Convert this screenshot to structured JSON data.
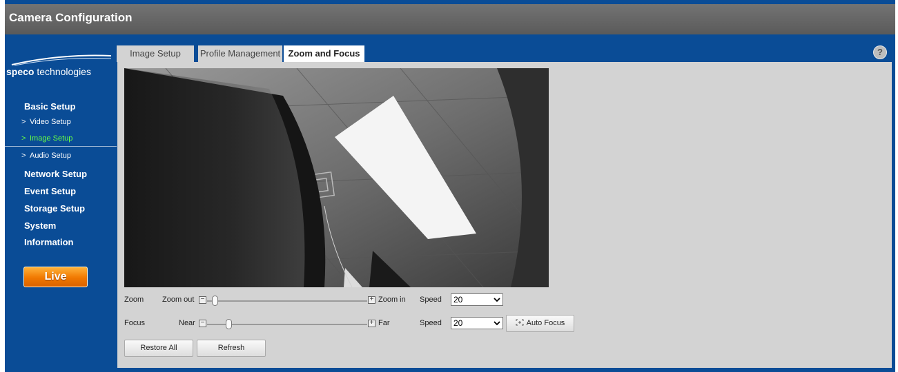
{
  "window": {
    "title": "Camera Configuration"
  },
  "logo": {
    "brand_bold": "speco",
    "brand_rest": " technologies"
  },
  "sidebar": {
    "basic_setup": "Basic Setup",
    "video_setup": "Video Setup",
    "image_setup": "Image Setup",
    "audio_setup": "Audio Setup",
    "network_setup": "Network Setup",
    "event_setup": "Event Setup",
    "storage_setup": "Storage Setup",
    "system": "System",
    "information": "Information",
    "live": "Live",
    "active_item": "Image Setup"
  },
  "tabs": {
    "image_setup": "Image Setup",
    "profile_management": "Profile Management",
    "zoom_and_focus": "Zoom and Focus",
    "selected": "Zoom and Focus"
  },
  "help_icon": "?",
  "zoom": {
    "label": "Zoom",
    "minus_label": "Zoom out",
    "plus_label": "Zoom in",
    "position_percent": 3,
    "speed_label": "Speed",
    "speed_value": "20"
  },
  "focus": {
    "label": "Focus",
    "minus_label": "Near",
    "plus_label": "Far",
    "position_percent": 12,
    "speed_label": "Speed",
    "speed_value": "20",
    "auto_focus_label": "Auto Focus"
  },
  "buttons": {
    "restore_all": "Restore All",
    "refresh": "Refresh"
  },
  "colors": {
    "frame_blue": "#0a4c96",
    "panel_gray": "#d3d3d3",
    "active_nav_green": "#66ff44",
    "live_orange": "#f07800"
  }
}
